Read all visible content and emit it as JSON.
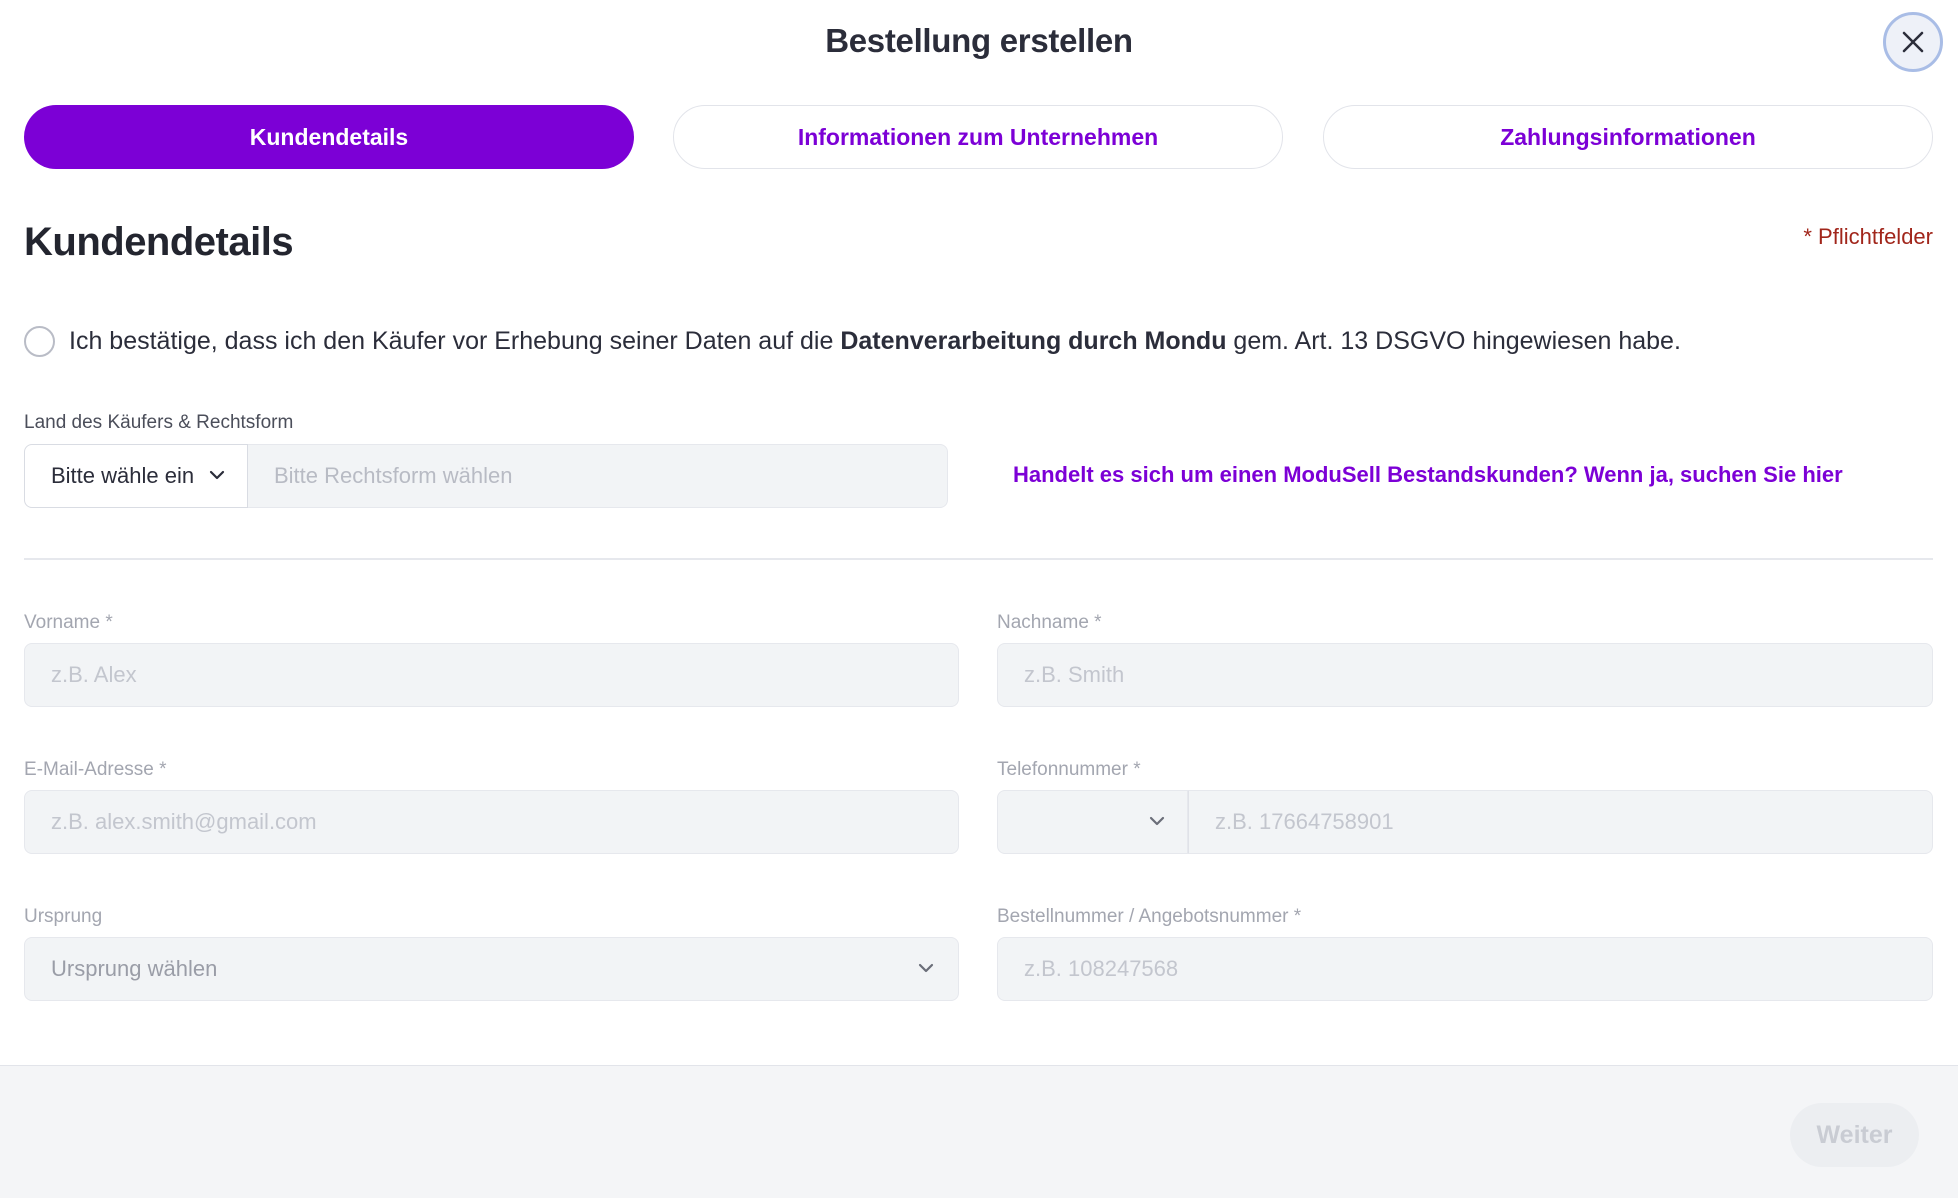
{
  "modal": {
    "title": "Bestellung erstellen"
  },
  "steps": [
    {
      "label": "Kundendetails",
      "active": true
    },
    {
      "label": "Informationen zum Unternehmen",
      "active": false
    },
    {
      "label": "Zahlungsinformationen",
      "active": false
    }
  ],
  "section": {
    "title": "Kundendetails",
    "required_note": "* Pflichtfelder"
  },
  "consent": {
    "text_before": "Ich bestätige, dass ich den Käufer vor Erhebung seiner Daten auf die ",
    "text_bold": "Datenverarbeitung durch Mondu",
    "text_after": " gem. Art. 13 DSGVO hingewiesen habe.",
    "checked": false
  },
  "country_legal": {
    "label": "Land des Käufers & Rechtsform",
    "country_value": "Bitte wähle ein",
    "legal_form_placeholder": "Bitte Rechtsform wählen"
  },
  "existing_customer_link": "Handelt es sich um einen ModuSell Bestandskunden? Wenn ja, suchen Sie hier",
  "fields": {
    "first_name": {
      "label": "Vorname *",
      "placeholder": "z.B. Alex"
    },
    "last_name": {
      "label": "Nachname *",
      "placeholder": "z.B. Smith"
    },
    "email": {
      "label": "E-Mail-Adresse *",
      "placeholder": "z.B. alex.smith@gmail.com"
    },
    "phone": {
      "label": "Telefonnummer *",
      "placeholder": "z.B. 17664758901"
    },
    "origin": {
      "label": "Ursprung",
      "placeholder": "Ursprung wählen"
    },
    "order_number": {
      "label": "Bestellnummer / Angebotsnummer *",
      "placeholder": "z.B. 108247568"
    }
  },
  "footer": {
    "next_label": "Weiter"
  },
  "colors": {
    "accent": "#7c00d6",
    "required": "#a1261b",
    "text": "#2b2d3a"
  }
}
